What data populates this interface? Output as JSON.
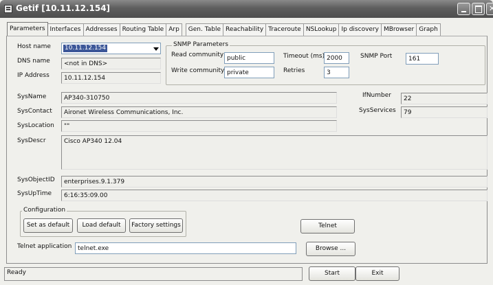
{
  "window": {
    "title": "Getif [10.11.12.154]"
  },
  "tabs": [
    {
      "label": "Parameters",
      "active": true
    },
    {
      "label": "Interfaces"
    },
    {
      "label": "Addresses"
    },
    {
      "label": "Routing Table"
    },
    {
      "label": "Arp"
    },
    {
      "label": "Gen. Table"
    },
    {
      "label": "Reachability"
    },
    {
      "label": "Traceroute"
    },
    {
      "label": "NSLookup"
    },
    {
      "label": "Ip discovery"
    },
    {
      "label": "MBrowser"
    },
    {
      "label": "Graph"
    }
  ],
  "host": {
    "hostname_label": "Host name",
    "hostname_value": "10.11.12.154",
    "dns_label": "DNS name",
    "dns_value": "<not in DNS>",
    "ip_label": "IP Address",
    "ip_value": "10.11.12.154"
  },
  "snmp": {
    "group_label": "SNMP Parameters",
    "read_label": "Read community",
    "read_value": "public",
    "write_label": "Write community",
    "write_value": "private",
    "timeout_label": "Timeout (ms)",
    "timeout_value": "2000",
    "retries_label": "Retries",
    "retries_value": "3",
    "port_label": "SNMP Port",
    "port_value": "161"
  },
  "sys": {
    "name_label": "SysName",
    "name_value": "AP340-310750",
    "contact_label": "SysContact",
    "contact_value": "Aironet Wireless Communications, Inc.",
    "location_label": "SysLocation",
    "location_value": "\"\"",
    "descr_label": "SysDescr",
    "descr_value": "Cisco AP340 12.04",
    "objectid_label": "SysObjectID",
    "objectid_value": "enterprises.9.1.379",
    "uptime_label": "SysUpTime",
    "uptime_value": "6:16:35:09.00",
    "ifnumber_label": "IfNumber",
    "ifnumber_value": "22",
    "services_label": "SysServices",
    "services_value": "79"
  },
  "config": {
    "group_label": "Configuration",
    "set_default": "Set as default",
    "load_default": "Load default",
    "factory": "Factory settings",
    "telnet": "Telnet"
  },
  "telnet_app": {
    "label": "Telnet application",
    "value": "telnet.exe",
    "browse": "Browse ..."
  },
  "status": {
    "text": "Ready",
    "start": "Start",
    "exit": "Exit"
  }
}
